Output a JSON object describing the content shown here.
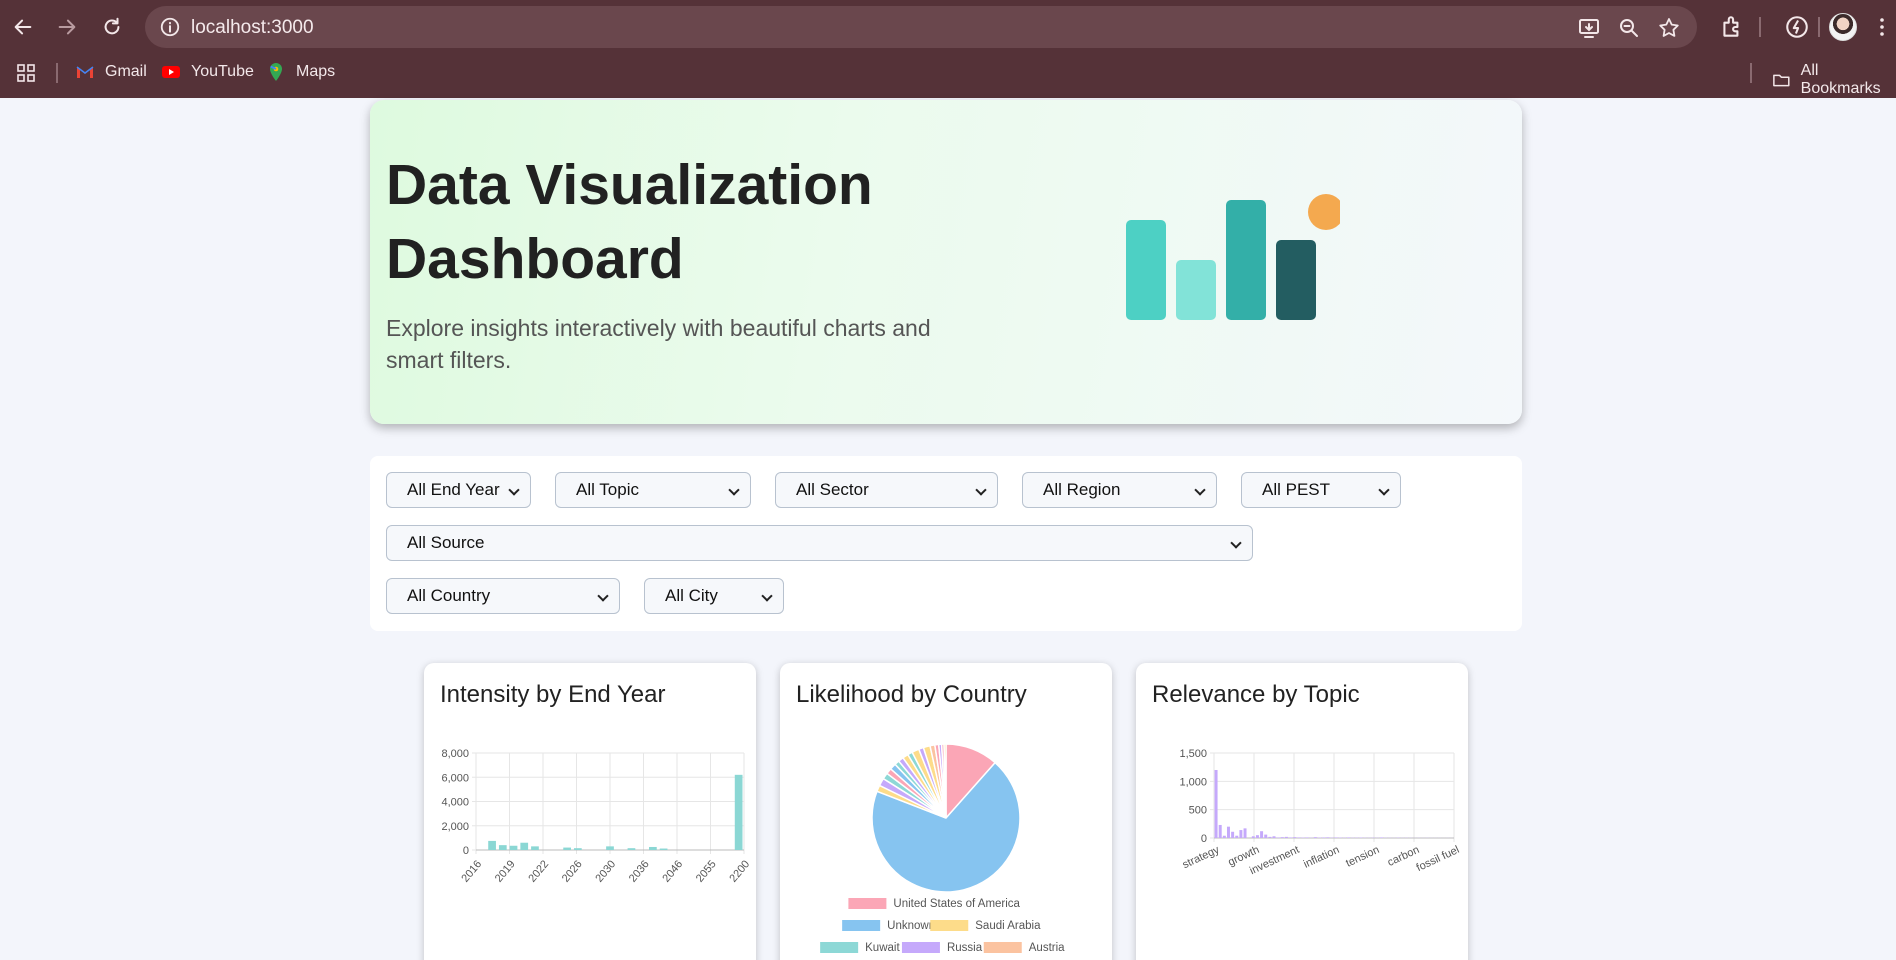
{
  "browser": {
    "url": "localhost:3000",
    "bookmarks": [
      "Gmail",
      "YouTube",
      "Maps"
    ],
    "all_bookmarks": "All Bookmarks"
  },
  "hero": {
    "title": "Data Visualization Dashboard",
    "subtitle": "Explore insights interactively with beautiful charts and smart filters.",
    "art_colors": [
      "#4dd0c4",
      "#82e3d8",
      "#33afa8",
      "#235d61",
      "#f4a94f"
    ]
  },
  "filters": {
    "end_year": "All End Year",
    "topic": "All Topic",
    "sector": "All Sector",
    "region": "All Region",
    "pest": "All PEST",
    "source": "All Source",
    "country": "All Country",
    "city": "All City"
  },
  "chart_data": [
    {
      "type": "bar",
      "title": "Intensity by End Year",
      "color": "#8bd7d4",
      "ylim": [
        0,
        8000
      ],
      "yticks": [
        0,
        2000,
        4000,
        6000,
        8000
      ],
      "ytick_labels": [
        "0",
        "2,000",
        "4,000",
        "6,000",
        "8,000"
      ],
      "xtick_labels": [
        "2016",
        "2019",
        "2022",
        "2026",
        "2030",
        "2036",
        "2046",
        "2055",
        "2200"
      ],
      "values": [
        0,
        750,
        400,
        350,
        600,
        300,
        0,
        0,
        200,
        150,
        0,
        0,
        300,
        0,
        150,
        0,
        250,
        120,
        0,
        0,
        0,
        0,
        0,
        0,
        6200
      ],
      "grid": true
    },
    {
      "type": "pie",
      "title": "Likelihood by Country",
      "slices": [
        {
          "label": "United States of America",
          "value": 11,
          "color": "#fba6b6"
        },
        {
          "label": "Unknown",
          "value": 66,
          "color": "#86c4f0"
        },
        {
          "label": "",
          "value": 1.3,
          "color": "#fddc8a"
        },
        {
          "label": "",
          "value": 1.6,
          "color": "#c5a9fb"
        },
        {
          "label": "",
          "value": 1.3,
          "color": "#8dd8d6"
        },
        {
          "label": "",
          "value": 1.2,
          "color": "#fba6b6"
        },
        {
          "label": "",
          "value": 1.3,
          "color": "#86c4f0"
        },
        {
          "label": "",
          "value": 1.0,
          "color": "#8dd8d6"
        },
        {
          "label": "",
          "value": 1.1,
          "color": "#c5a9fb"
        },
        {
          "label": "",
          "value": 1.2,
          "color": "#fddc8a"
        },
        {
          "label": "",
          "value": 1.0,
          "color": "#8dd8d6"
        },
        {
          "label": "",
          "value": 1.5,
          "color": "#fddc8a"
        },
        {
          "label": "",
          "value": 1.0,
          "color": "#c5a9fb"
        },
        {
          "label": "",
          "value": 1.4,
          "color": "#fddc8a"
        },
        {
          "label": "",
          "value": 1.0,
          "color": "#fbc3a0"
        },
        {
          "label": "",
          "value": 0.8,
          "color": "#fba6b6"
        },
        {
          "label": "",
          "value": 0.6,
          "color": "#c5a9fb"
        },
        {
          "label": "",
          "value": 0.5,
          "color": "#fba6b6"
        },
        {
          "label": "",
          "value": 0.4,
          "color": "#fddc8a"
        }
      ],
      "legend": [
        {
          "label": "United States of America",
          "color": "#fba6b6"
        },
        {
          "label": "Unknown",
          "color": "#86c4f0"
        },
        {
          "label": "Saudi Arabia",
          "color": "#fddc8a"
        },
        {
          "label": "Kuwait",
          "color": "#8dd8d6"
        },
        {
          "label": "Russia",
          "color": "#c5a9fb"
        },
        {
          "label": "Austria",
          "color": "#fbc3a0"
        }
      ]
    },
    {
      "type": "bar",
      "title": "Relevance by Topic",
      "color": "#c5a9fb",
      "ylim": [
        0,
        1500
      ],
      "yticks": [
        0,
        500,
        1000,
        1500
      ],
      "ytick_labels": [
        "0",
        "500",
        "1,000",
        "1,500"
      ],
      "xtick_labels": [
        "strategy",
        "growth",
        "investment",
        "inflation",
        "tension",
        "carbon",
        "fossil fuel"
      ],
      "values": [
        1200,
        230,
        40,
        200,
        110,
        40,
        140,
        170,
        0,
        30,
        50,
        120,
        60,
        20,
        30,
        10,
        15,
        20,
        10,
        15,
        10,
        8,
        10,
        5,
        15,
        8,
        10,
        12,
        6,
        10,
        8,
        6,
        10,
        5,
        6,
        8,
        5,
        4,
        6,
        4,
        10,
        5,
        4,
        3,
        6,
        3,
        4,
        3,
        2,
        3,
        2,
        3,
        2,
        2,
        2,
        1,
        2,
        1
      ],
      "grid": true
    }
  ]
}
